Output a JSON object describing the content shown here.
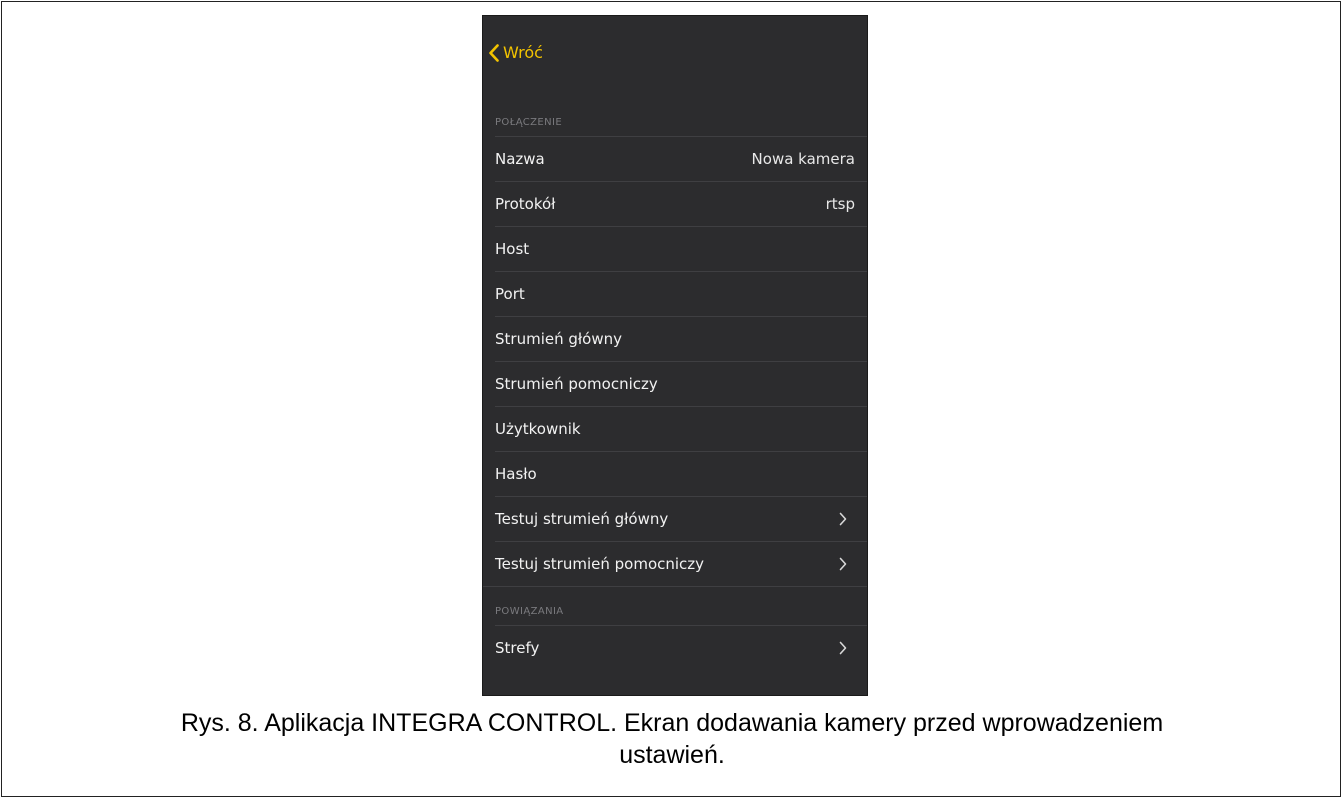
{
  "nav": {
    "back_label": "Wróć"
  },
  "sections": {
    "connection_header": "POŁĄCZENIE",
    "bindings_header": "POWIĄZANIA"
  },
  "connection_rows": [
    {
      "label": "Nazwa",
      "value": "Nowa kamera"
    },
    {
      "label": "Protokół",
      "value": "rtsp"
    },
    {
      "label": "Host",
      "value": ""
    },
    {
      "label": "Port",
      "value": ""
    },
    {
      "label": "Strumień główny",
      "value": ""
    },
    {
      "label": "Strumień pomocniczy",
      "value": ""
    },
    {
      "label": "Użytkownik",
      "value": ""
    },
    {
      "label": "Hasło",
      "value": ""
    },
    {
      "label": "Testuj strumień główny",
      "value": ""
    },
    {
      "label": "Testuj strumień pomocniczy",
      "value": ""
    }
  ],
  "binding_rows": [
    {
      "label": "Strefy"
    }
  ],
  "caption": {
    "line1": "Rys. 8. Aplikacja INTEGRA CONTROL. Ekran dodawania kamery przed wprowadzeniem",
    "line2": "ustawień."
  },
  "colors": {
    "accent": "#f2c300",
    "background": "#2c2c2e",
    "text": "#f2f2f2",
    "section_header": "#7a7a7e"
  },
  "icons": {
    "back": "chevron-left-icon",
    "disclosure": "chevron-right-icon"
  }
}
